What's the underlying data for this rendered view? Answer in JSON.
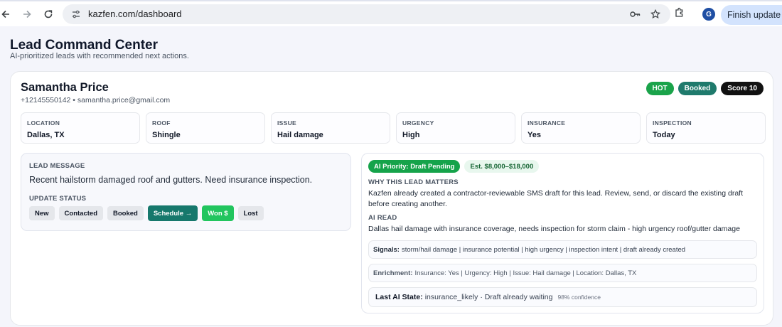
{
  "browser": {
    "url": "kazfen.com/dashboard",
    "profile_initial": "G",
    "finish_update_label": "Finish update"
  },
  "page": {
    "title": "Lead Command Center",
    "subtitle": "AI-prioritized leads with recommended next actions."
  },
  "lead": {
    "name": "Samantha Price",
    "contact": "+12145550142 • samantha.price@gmail.com",
    "badges": [
      {
        "label": "HOT",
        "color": "#1aa34a"
      },
      {
        "label": "Booked",
        "color": "#1f7a6c"
      },
      {
        "label": "Score 10",
        "color": "#111111"
      }
    ],
    "fields": [
      {
        "label": "LOCATION",
        "value": "Dallas, TX"
      },
      {
        "label": "ROOF",
        "value": "Shingle"
      },
      {
        "label": "ISSUE",
        "value": "Hail damage"
      },
      {
        "label": "URGENCY",
        "value": "High"
      },
      {
        "label": "INSURANCE",
        "value": "Yes"
      },
      {
        "label": "INSPECTION",
        "value": "Today"
      }
    ],
    "message_label": "LEAD MESSAGE",
    "message": "Recent hailstorm damaged roof and gutters. Need insurance inspection.",
    "update_status_label": "UPDATE STATUS",
    "status_buttons": [
      "New",
      "Contacted",
      "Booked",
      "Schedule →",
      "Won $",
      "Lost"
    ]
  },
  "ai": {
    "priority": "AI Priority: Draft Pending",
    "estimate": "Est. $8,000–$18,000",
    "why_label": "WHY THIS LEAD MATTERS",
    "why_text": "Kazfen already created a contractor-reviewable SMS draft for this lead. Review, send, or discard the existing draft before creating another.",
    "read_label": "AI READ",
    "read_text": "Dallas hail damage with insurance coverage, needs inspection for storm claim - high urgency roof/gutter damage",
    "signals_label": "Signals:",
    "signals_text": "storm/hail damage | insurance potential | high urgency | inspection intent | draft already created",
    "enrichment_label": "Enrichment:",
    "enrichment_text": "Insurance: Yes | Urgency: High | Issue: Hail damage | Location: Dallas, TX",
    "last_state_label": "Last AI State:",
    "last_state_text": "insurance_likely · Draft already waiting",
    "confidence": "98% confidence"
  }
}
